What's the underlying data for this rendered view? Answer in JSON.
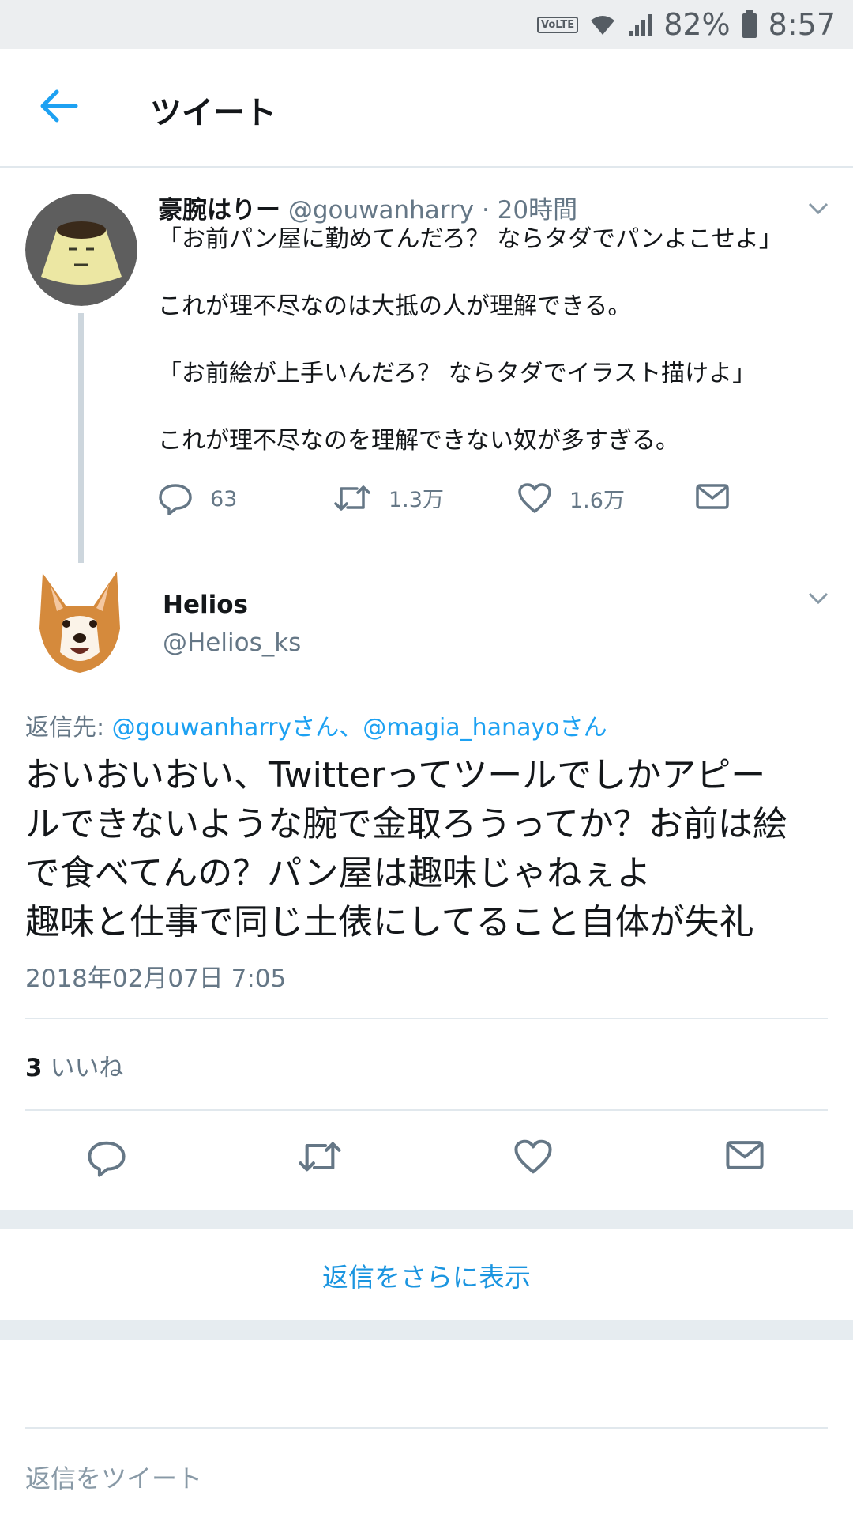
{
  "status_bar": {
    "volte": "VoLTE",
    "battery_pct": "82%",
    "time": "8:57"
  },
  "header": {
    "title": "ツイート",
    "back_icon": "arrow-left-icon"
  },
  "tweet1": {
    "name": "豪腕はりー",
    "handle": "@gouwanharry",
    "time": "· 20時間",
    "lines": [
      "「お前パン屋に勤めてんだろ？ ならタダでパンよこせよ」",
      "これが理不尽なのは大抵の人が理解できる。",
      "「お前絵が上手いんだろ？ ならタダでイラスト描けよ」",
      "これが理不尽なのを理解できない奴が多すぎる。"
    ],
    "replies": "63",
    "retweets": "1.3万",
    "likes": "1.6万"
  },
  "tweet2": {
    "name": "Helios",
    "handle": "@Helios_ks",
    "reply_prefix": "返信先: ",
    "reply_targets": "@gouwanharryさん、@magia_hanayoさん",
    "body_lines": [
      "おいおいおい、Twitterってツールでしかアピー",
      "ルできないような腕で金取ろうってか？お前は絵",
      "で食べてんの？パン屋は趣味じゃねぇよ",
      "趣味と仕事で同じ土俵にしてること自体が失礼"
    ],
    "timestamp": "2018年02月07日 7:05",
    "like_count": "3",
    "like_label": "いいね"
  },
  "more_replies": "返信をさらに表示",
  "compose_placeholder": "返信をツイート",
  "colors": {
    "accent": "#1da1f2",
    "text": "#14171a",
    "secondary": "#657786",
    "divider": "#e1e8ed"
  }
}
